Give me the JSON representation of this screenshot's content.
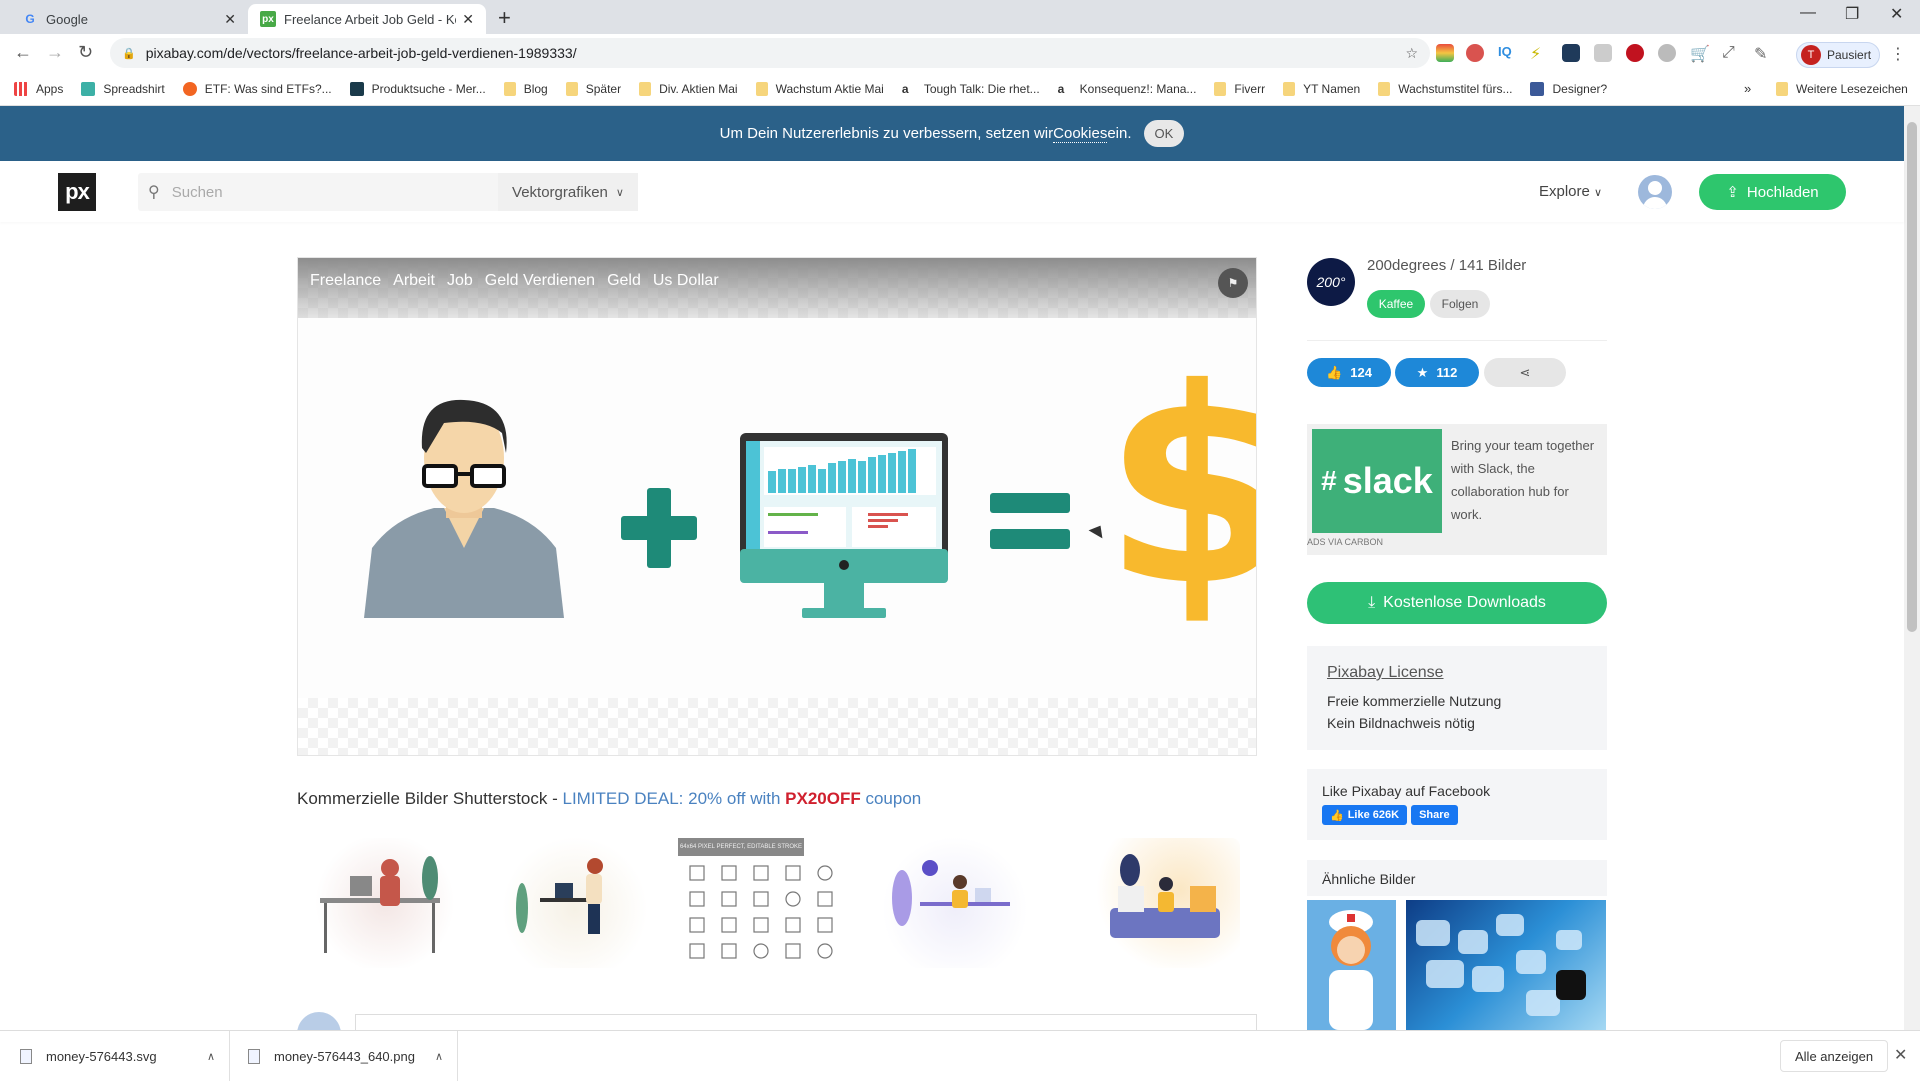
{
  "browser": {
    "tabs": [
      {
        "title": "Google",
        "active": false
      },
      {
        "title": "Freelance Arbeit Job Geld - Koste",
        "active": true
      }
    ],
    "url": "pixabay.com/de/vectors/freelance-arbeit-job-geld-verdienen-1989333/",
    "profile": {
      "initial": "T",
      "label": "Pausiert"
    },
    "bookmarks": [
      {
        "label": "Apps",
        "icon": "apps-grid-icon"
      },
      {
        "label": "Spreadshirt",
        "icon": "spreadshirt-icon"
      },
      {
        "label": "ETF: Was sind ETFs?...",
        "icon": "etf-icon"
      },
      {
        "label": "Produktsuche - Mer...",
        "icon": "shirt-icon"
      },
      {
        "label": "Blog",
        "icon": "folder-icon"
      },
      {
        "label": "Später",
        "icon": "folder-icon"
      },
      {
        "label": "Div. Aktien Mai",
        "icon": "folder-icon"
      },
      {
        "label": "Wachstum Aktie Mai",
        "icon": "folder-icon"
      },
      {
        "label": "Tough Talk: Die rhet...",
        "icon": "amazon-icon"
      },
      {
        "label": "Konsequenz!: Mana...",
        "icon": "amazon-icon"
      },
      {
        "label": "Fiverr",
        "icon": "folder-icon"
      },
      {
        "label": "YT Namen",
        "icon": "folder-icon"
      },
      {
        "label": "Wachstumstitel fürs...",
        "icon": "folder-icon"
      },
      {
        "label": "Designer?",
        "icon": "facebook-icon"
      }
    ],
    "bookmarks_more": "»",
    "bookmarks_other": "Weitere Lesezeichen"
  },
  "cookie_banner": {
    "text_before": "Um Dein Nutzererlebnis zu verbessern, setzen wir ",
    "link": "Cookies",
    "text_after": " ein.",
    "ok": "OK"
  },
  "header": {
    "logo": "px",
    "search_placeholder": "Suchen",
    "search_type": "Vektorgrafiken",
    "explore": "Explore",
    "upload": "Hochladen"
  },
  "image": {
    "tags": [
      "Freelance",
      "Arbeit",
      "Job",
      "Geld Verdienen",
      "Geld",
      "Us Dollar"
    ],
    "colors": {
      "teal": "#1e8a78",
      "dollar": "#f8b92d",
      "screen": "#4cc3d6"
    }
  },
  "shutterstock": {
    "prefix": "Kommerzielle Bilder Shutterstock - ",
    "deal": "LIMITED DEAL: 20% off with ",
    "code": "PX20OFF",
    "suffix": " coupon",
    "icon_banner": "64x64 PIXEL PERFECT, EDITABLE STROKE"
  },
  "author": {
    "avatar_text": "200°",
    "name_line": "200degrees / 141 Bilder",
    "coffee": "Kaffee",
    "follow": "Folgen"
  },
  "stats": {
    "likes": "124",
    "favorites": "112"
  },
  "ad": {
    "brand": "slack",
    "text": "Bring your team together with Slack, the collaboration hub for work.",
    "via": "ADS VIA CARBON"
  },
  "download_button": "Kostenlose Downloads",
  "license": {
    "title": "Pixabay License",
    "lines": [
      "Freie kommerzielle Nutzung",
      "Kein Bildnachweis nötig"
    ]
  },
  "facebook": {
    "title": "Like Pixabay auf Facebook",
    "like": "Like 626K",
    "share": "Share"
  },
  "similar": {
    "title": "Ähnliche Bilder"
  },
  "downloads_bar": {
    "items": [
      "money-576443.svg",
      "money-576443_640.png"
    ],
    "show_all": "Alle anzeigen"
  },
  "colors": {
    "brand_green": "#2ec66d",
    "banner_blue": "#2b6189",
    "stat_blue": "#1e88d8",
    "code_red": "#d0202e"
  }
}
